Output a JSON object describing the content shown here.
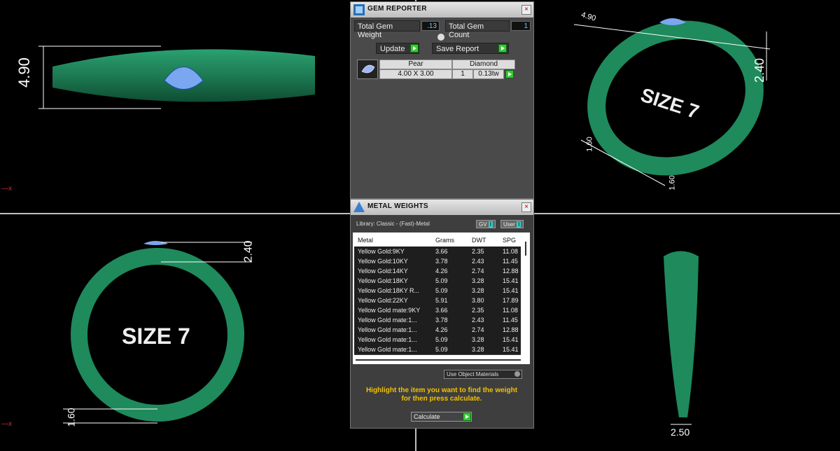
{
  "viewports": {
    "top_left": {
      "dim_label": "4.90"
    },
    "top_right": {
      "dim_top": "4.90",
      "dim_right": "2.40",
      "dim_bottom": "1.60",
      "dim_bottom2": "1.60",
      "ring_text": "SIZE 7"
    },
    "bottom_left": {
      "dim_top": "2.40",
      "dim_bottom": "1.60",
      "ring_text": "SIZE 7"
    },
    "bottom_right": {
      "dim_bottom": "2.50"
    },
    "axis_marks": [
      "x",
      "x"
    ]
  },
  "gem_reporter": {
    "title": "GEM REPORTER",
    "close": "×",
    "total_weight_label": "Total Gem Weight",
    "total_weight_value": ".13",
    "total_count_label": "Total Gem Count",
    "total_count_value": "1",
    "update_label": "Update",
    "save_report_label": "Save Report",
    "gem": {
      "shape": "Pear",
      "type": "Diamond",
      "size": "4.00 X 3.00",
      "qty": "1",
      "weight": "0.13tw"
    }
  },
  "metal_weights": {
    "title": "METAL WEIGHTS",
    "close": "×",
    "library": "Library: Classic - (Fast)-Metal",
    "gv_label": "GV",
    "user_label": "User",
    "columns": [
      "Metal",
      "Grams",
      "DWT",
      "SPG"
    ],
    "rows": [
      [
        "Yellow Gold:9KY",
        "3.66",
        "2.35",
        "11.08"
      ],
      [
        "Yellow Gold:10KY",
        "3.78",
        "2.43",
        "11.45"
      ],
      [
        "Yellow Gold:14KY",
        "4.26",
        "2.74",
        "12.88"
      ],
      [
        "Yellow Gold:18KY",
        "5.09",
        "3.28",
        "15.41"
      ],
      [
        "Yellow Gold:18KY R...",
        "5.09",
        "3.28",
        "15.41"
      ],
      [
        "Yellow Gold:22KY",
        "5.91",
        "3.80",
        "17.89"
      ],
      [
        "Yellow Gold mate:9KY",
        "3.66",
        "2.35",
        "11.08"
      ],
      [
        "Yellow Gold mate:1...",
        "3.78",
        "2.43",
        "11.45"
      ],
      [
        "Yellow Gold mate:1...",
        "4.26",
        "2.74",
        "12.88"
      ],
      [
        "Yellow Gold mate:1...",
        "5.09",
        "3.28",
        "15.41"
      ],
      [
        "Yellow Gold mate:1...",
        "5.09",
        "3.28",
        "15.41"
      ]
    ],
    "use_object_materials": "Use Object Materials",
    "hint": "Highlight the item you want to find the weight for then press calculate.",
    "calculate_label": "Calculate"
  },
  "colors": {
    "ring": "#1f8a5c",
    "gem": "#7aa7f0",
    "panel_bg": "#4a4a4a",
    "hint": "#f2c200",
    "go_button": "#33cc33"
  }
}
